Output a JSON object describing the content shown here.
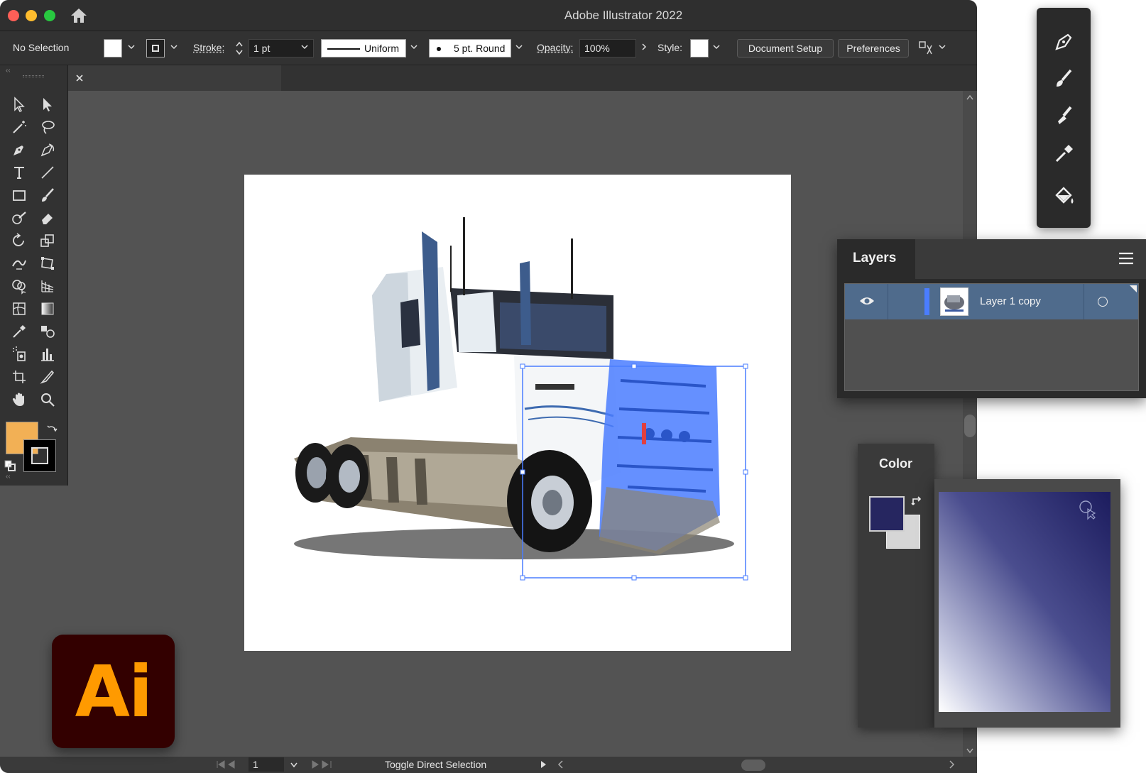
{
  "window": {
    "title": "Adobe Illustrator 2022"
  },
  "control_bar": {
    "selection": "No Selection",
    "stroke_label": "Stroke:",
    "stroke_value": "1 pt",
    "profile": "Uniform",
    "brush": "5 pt. Round",
    "opacity_label": "Opacity:",
    "opacity_value": "100%",
    "style_label": "Style:",
    "document_setup": "Document Setup",
    "preferences": "Preferences"
  },
  "toolbar": {
    "fill_color": "#f2b055",
    "stroke_color": "#000000"
  },
  "layers_panel": {
    "title": "Layers",
    "layers": [
      {
        "name": "Layer 1 copy",
        "visible": true,
        "color": "#4a7dff"
      }
    ]
  },
  "color_panel": {
    "title": "Color",
    "fill_color": "#262660",
    "stroke_color": "#d6d6d6"
  },
  "status_bar": {
    "artboard_number": "1",
    "tool_hint": "Toggle Direct Selection"
  },
  "logo": {
    "text": "Ai",
    "brand_color": "#ff9a00",
    "background": "#330000"
  }
}
